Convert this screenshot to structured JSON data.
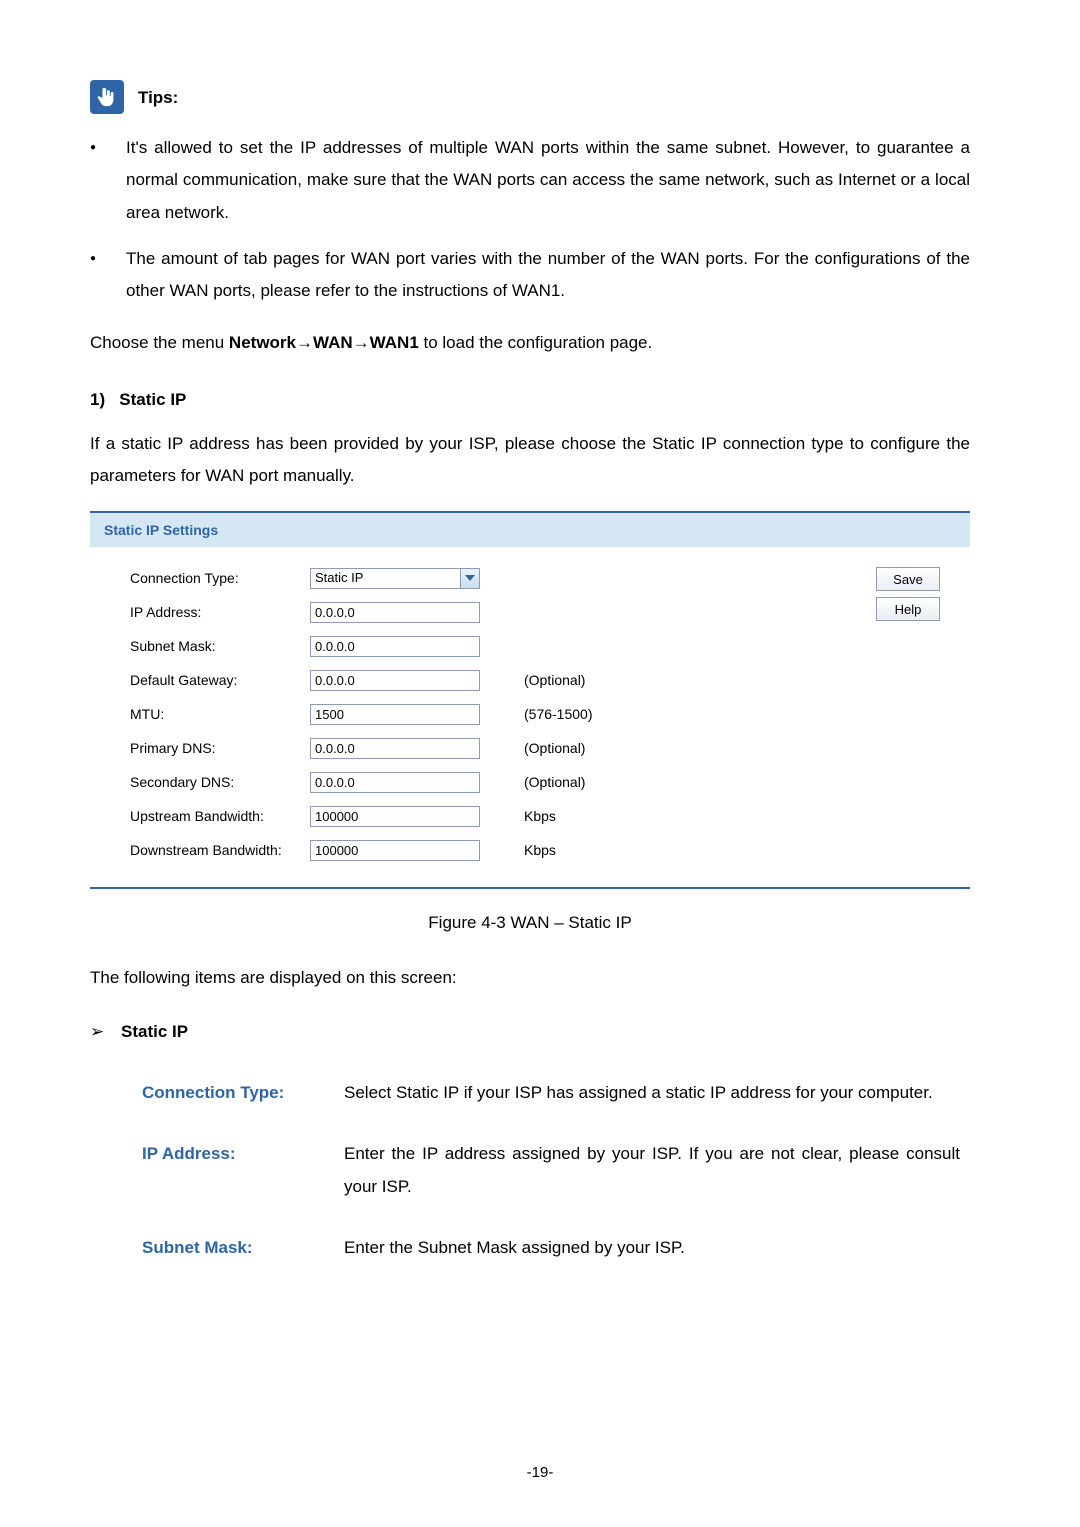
{
  "tips": {
    "icon_name": "hand-pointer-icon",
    "label": "Tips:",
    "items": [
      "It's allowed to set the IP addresses of multiple WAN ports within the same subnet. However, to guarantee a normal communication, make sure that the WAN ports can access the same network, such as Internet or a local area network.",
      "The amount of tab pages for WAN port varies with the number of the WAN ports. For the configurations of the other WAN ports, please refer to the instructions of WAN1."
    ]
  },
  "menu_path": {
    "prefix": "Choose the menu ",
    "bold": "Network→WAN→WAN1",
    "suffix": " to load the configuration page."
  },
  "section1": {
    "number": "1)",
    "title": "Static IP",
    "intro": "If a static IP address has been provided by your ISP, please choose the Static IP connection type to configure the parameters for WAN port manually."
  },
  "panel": {
    "title": "Static IP Settings",
    "buttons": {
      "save": "Save",
      "help": "Help"
    },
    "rows": {
      "connection_type": {
        "label": "Connection Type:",
        "value": "Static IP",
        "hint": ""
      },
      "ip_address": {
        "label": "IP Address:",
        "value": "0.0.0.0",
        "hint": ""
      },
      "subnet_mask": {
        "label": "Subnet Mask:",
        "value": "0.0.0.0",
        "hint": ""
      },
      "default_gateway": {
        "label": "Default Gateway:",
        "value": "0.0.0.0",
        "hint": "(Optional)"
      },
      "mtu": {
        "label": "MTU:",
        "value": "1500",
        "hint": "(576-1500)"
      },
      "primary_dns": {
        "label": "Primary DNS:",
        "value": "0.0.0.0",
        "hint": "(Optional)"
      },
      "secondary_dns": {
        "label": "Secondary DNS:",
        "value": "0.0.0.0",
        "hint": "(Optional)"
      },
      "upstream_bw": {
        "label": "Upstream Bandwidth:",
        "value": "100000",
        "hint": "Kbps"
      },
      "downstream_bw": {
        "label": "Downstream Bandwidth:",
        "value": "100000",
        "hint": "Kbps"
      }
    }
  },
  "figure_caption": "Figure 4-3 WAN – Static IP",
  "following_items": "The following items are displayed on this screen:",
  "arrow_heading": "Static IP",
  "descriptions": {
    "connection_type": {
      "label": "Connection Type:",
      "text": "Select Static IP if your ISP has assigned a static IP address for your computer."
    },
    "ip_address": {
      "label": "IP Address:",
      "text": "Enter the IP address assigned by your ISP. If you are not clear, please consult your ISP."
    },
    "subnet_mask": {
      "label": "Subnet Mask:",
      "text": "Enter the Subnet Mask assigned by your ISP."
    }
  },
  "page_number": "-19-"
}
